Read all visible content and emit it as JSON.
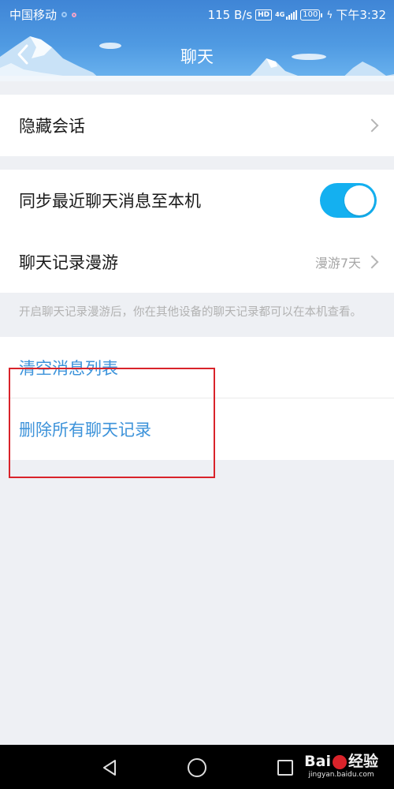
{
  "status_bar": {
    "carrier": "中国移动",
    "speed": "115 B/s",
    "hd_badge": "HD",
    "network": "4G",
    "battery": "100",
    "time": "下午3:32"
  },
  "header": {
    "title": "聊天",
    "back_icon": "chevron-left-icon"
  },
  "sections": {
    "hide_chat": {
      "label": "隐藏会话"
    },
    "sync": {
      "label": "同步最近聊天消息至本机",
      "enabled": true
    },
    "roaming": {
      "label": "聊天记录漫游",
      "value": "漫游7天"
    },
    "roaming_hint": "开启聊天记录漫游后，你在其他设备的聊天记录都可以在本机查看。",
    "clear_list": {
      "label": "清空消息列表"
    },
    "delete_all": {
      "label": "删除所有聊天记录"
    }
  },
  "nav_bar": {
    "icons": [
      "back-triangle-icon",
      "home-circle-icon",
      "recent-square-icon"
    ]
  },
  "watermark": {
    "brand_left": "Bai",
    "brand_right": "经验",
    "url": "jingyan.baidu.com"
  },
  "colors": {
    "header_blue": "#4f9ae2",
    "toggle_on": "#14b0f0",
    "action_text": "#3d93da",
    "highlight_border": "#d9232a"
  }
}
